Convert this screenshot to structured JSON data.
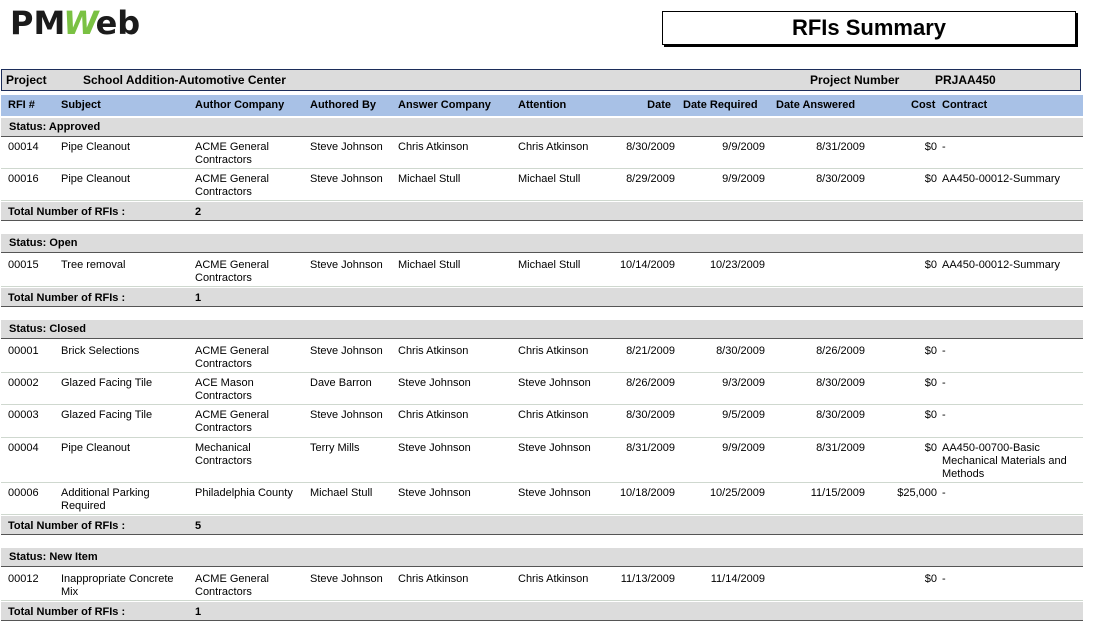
{
  "header": {
    "logo": {
      "part1": "PM",
      "part2": "W",
      "part3": "eb"
    },
    "title": "RFIs Summary"
  },
  "project": {
    "project_label": "Project",
    "project_value": "School Addition-Automotive Center",
    "number_label": "Project Number",
    "number_value": "PRJAA450"
  },
  "columns": {
    "rfi": "RFI #",
    "subject": "Subject",
    "author_company": "Author Company",
    "authored_by": "Authored By",
    "answer_company": "Answer Company",
    "attention": "Attention",
    "date": "Date",
    "date_required": "Date Required",
    "date_answered": "Date Answered",
    "cost": "Cost",
    "contract": "Contract"
  },
  "groups": {
    "approved": {
      "status": "Status:  Approved",
      "total_label": "Total Number of RFIs :",
      "total": "2",
      "rows": [
        {
          "rfi": "00014",
          "subject": "Pipe Cleanout",
          "author_company": "ACME General Contractors",
          "authored_by": "Steve Johnson",
          "answer_company": "Chris Atkinson",
          "attention": "Chris Atkinson",
          "date": "8/30/2009",
          "date_required": "9/9/2009",
          "date_answered": "8/31/2009",
          "cost": "$0",
          "contract": "-"
        },
        {
          "rfi": "00016",
          "subject": "Pipe Cleanout",
          "author_company": "ACME General Contractors",
          "authored_by": "Steve Johnson",
          "answer_company": "Michael Stull",
          "attention": "Michael Stull",
          "date": "8/29/2009",
          "date_required": "9/9/2009",
          "date_answered": "8/30/2009",
          "cost": "$0",
          "contract": "AA450-00012-Summary"
        }
      ]
    },
    "open": {
      "status": "Status:  Open",
      "total_label": "Total Number of RFIs :",
      "total": "1",
      "rows": [
        {
          "rfi": "00015",
          "subject": "Tree removal",
          "author_company": "ACME General Contractors",
          "authored_by": "Steve Johnson",
          "answer_company": "Michael Stull",
          "attention": "Michael Stull",
          "date": "10/14/2009",
          "date_required": "10/23/2009",
          "date_answered": "",
          "cost": "$0",
          "contract": "AA450-00012-Summary"
        }
      ]
    },
    "closed": {
      "status": "Status:  Closed",
      "total_label": "Total Number of RFIs :",
      "total": "5",
      "rows": [
        {
          "rfi": "00001",
          "subject": "Brick Selections",
          "author_company": "ACME General Contractors",
          "authored_by": "Steve Johnson",
          "answer_company": "Chris Atkinson",
          "attention": "Chris Atkinson",
          "date": "8/21/2009",
          "date_required": "8/30/2009",
          "date_answered": "8/26/2009",
          "cost": "$0",
          "contract": "-"
        },
        {
          "rfi": "00002",
          "subject": "Glazed Facing Tile",
          "author_company": "ACE Mason Contractors",
          "authored_by": "Dave Barron",
          "answer_company": "Steve Johnson",
          "attention": "Steve Johnson",
          "date": "8/26/2009",
          "date_required": "9/3/2009",
          "date_answered": "8/30/2009",
          "cost": "$0",
          "contract": "-"
        },
        {
          "rfi": "00003",
          "subject": "Glazed Facing Tile",
          "author_company": "ACME General Contractors",
          "authored_by": "Steve Johnson",
          "answer_company": "Chris Atkinson",
          "attention": "Chris Atkinson",
          "date": "8/30/2009",
          "date_required": "9/5/2009",
          "date_answered": "8/30/2009",
          "cost": "$0",
          "contract": "-"
        },
        {
          "rfi": "00004",
          "subject": "Pipe Cleanout",
          "author_company": "Mechanical Contractors",
          "authored_by": "Terry Mills",
          "answer_company": "Steve Johnson",
          "attention": "Steve Johnson",
          "date": "8/31/2009",
          "date_required": "9/9/2009",
          "date_answered": "8/31/2009",
          "cost": "$0",
          "contract": "AA450-00700-Basic Mechanical Materials and Methods"
        },
        {
          "rfi": "00006",
          "subject": "Additional Parking Required",
          "author_company": "Philadelphia County",
          "authored_by": "Michael Stull",
          "answer_company": "Steve Johnson",
          "attention": "Steve Johnson",
          "date": "10/18/2009",
          "date_required": "10/25/2009",
          "date_answered": "11/15/2009",
          "cost": "$25,000",
          "contract": "-"
        }
      ]
    },
    "new_item": {
      "status": "Status:  New Item",
      "total_label": "Total Number of RFIs :",
      "total": "1",
      "rows": [
        {
          "rfi": "00012",
          "subject": "Inappropriate Concrete Mix",
          "author_company": "ACME General Contractors",
          "authored_by": "Steve Johnson",
          "answer_company": "Chris Atkinson",
          "attention": "Chris Atkinson",
          "date": "11/13/2009",
          "date_required": "11/14/2009",
          "date_answered": "",
          "cost": "$0",
          "contract": "-"
        }
      ]
    }
  }
}
